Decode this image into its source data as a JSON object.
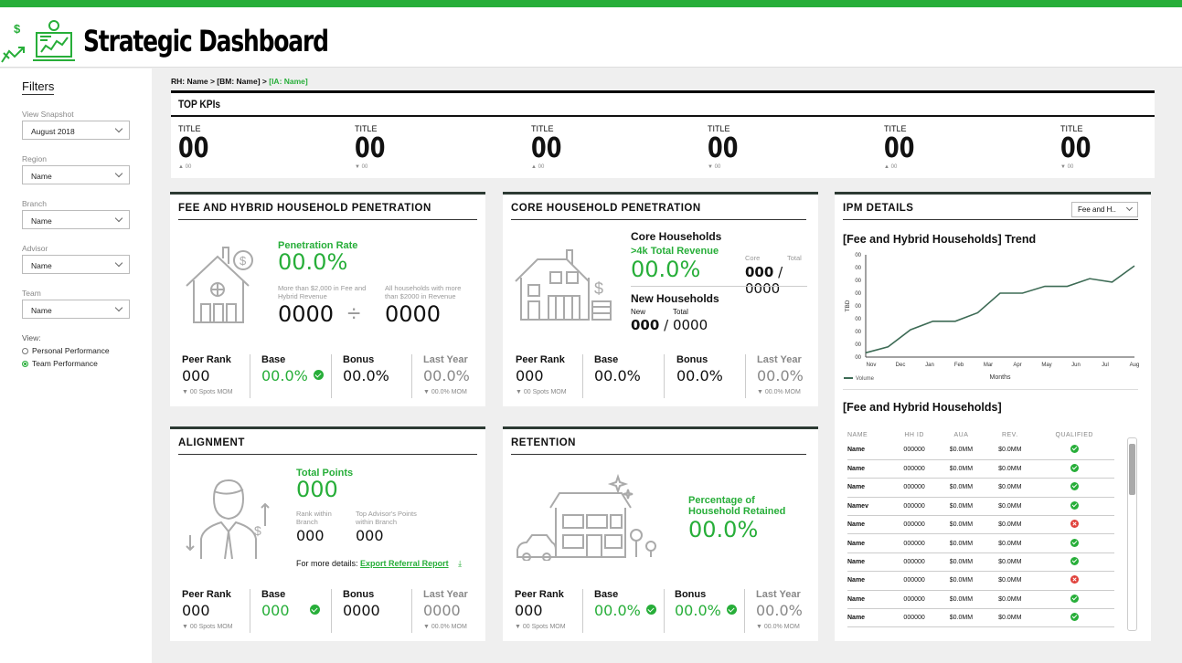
{
  "app": {
    "title": "Strategic Dashboard"
  },
  "sidebar": {
    "title": "Filters",
    "filters": [
      {
        "label": "View Snapshot",
        "value": "August 2018"
      },
      {
        "label": "Region",
        "value": "Name"
      },
      {
        "label": "Branch",
        "value": "Name"
      },
      {
        "label": "Advisor",
        "value": "Name"
      },
      {
        "label": "Team",
        "value": "Name"
      }
    ],
    "view_label": "View:",
    "view_options": [
      {
        "label": "Personal Performance",
        "selected": false
      },
      {
        "label": "Team Performance",
        "selected": true
      }
    ]
  },
  "breadcrumb": {
    "path": "RH: Name > [BM: Name]  >",
    "current": "[IA: Name]"
  },
  "kpis": {
    "title": "TOP KPIs",
    "items": [
      {
        "title": "TITLE",
        "value": "00",
        "change": "▲ 00",
        "trend": "up"
      },
      {
        "title": "TITLE",
        "value": "00",
        "change": "▼ 00",
        "trend": "down"
      },
      {
        "title": "TITLE",
        "value": "00",
        "change": "▲ 00",
        "trend": "up"
      },
      {
        "title": "TITLE",
        "value": "00",
        "change": "▼ 00",
        "trend": "down"
      },
      {
        "title": "TITLE",
        "value": "00",
        "change": "▲ 00",
        "trend": "up"
      },
      {
        "title": "TITLE",
        "value": "00",
        "change": "▼ 00",
        "trend": "down"
      }
    ]
  },
  "fee_card": {
    "title": "FEE AND HYBRID HOUSEHOLD PENETRATION",
    "rate_label": "Penetration Rate",
    "rate_value": "00.0%",
    "num_desc": "More than $2,000 in Fee and Hybrid Revenue",
    "den_desc": "All households with more than $2000 in Revenue",
    "num": "0000",
    "divide": "÷",
    "den": "0000",
    "peer_label": "Peer Rank",
    "peer_value": "000",
    "peer_sub": "▼ 00 Spots MOM",
    "base_label": "Base",
    "base_value": "00.0%",
    "bonus_label": "Bonus",
    "bonus_value": "00.0%",
    "ly_label": "Last Year",
    "ly_value": "00.0%",
    "ly_sub": "▼ 00.0% MOM"
  },
  "core_card": {
    "title": "CORE HOUSEHOLD PENETRATION",
    "core_title": "Core Households",
    "core_sub": ">4k Total Revenue",
    "core_value": "00.0%",
    "core_col": "Core",
    "total_col": "Total",
    "core_num": "000",
    "slash": "/",
    "core_total": "0000",
    "new_title": "New Households",
    "new_col": "New",
    "new_total_col": "Total",
    "new_num": "000",
    "new_total": "0000",
    "peer_label": "Peer Rank",
    "peer_value": "000",
    "peer_sub": "▼ 00 Spots MOM",
    "base_label": "Base",
    "base_value": "00.0%",
    "bonus_label": "Bonus",
    "bonus_value": "00.0%",
    "ly_label": "Last Year",
    "ly_value": "00.0%",
    "ly_sub": "▼ 00.0% MOM"
  },
  "align_card": {
    "title": "ALIGNMENT",
    "points_label": "Total Points",
    "points_value": "000",
    "rank_label": "Rank within Branch",
    "rank_value": "000",
    "top_label": "Top Advisor's Points within Branch",
    "top_value": "000",
    "details_text": "For more details:",
    "details_link": "Export Referral Report",
    "peer_label": "Peer Rank",
    "peer_value": "000",
    "peer_sub": "▼ 00 Spots MOM",
    "base_label": "Base",
    "base_value": "000",
    "bonus_label": "Bonus",
    "bonus_value": "0000",
    "ly_label": "Last Year",
    "ly_value": "0000",
    "ly_sub": "▼ 00.0% MOM"
  },
  "ret_card": {
    "title": "RETENTION",
    "pct_label": "Percentage of Household Retained",
    "pct_value": "00.0%",
    "peer_label": "Peer Rank",
    "peer_value": "000",
    "peer_sub": "▼ 00 Spots MOM",
    "base_label": "Base",
    "base_value": "00.0%",
    "bonus_label": "Bonus",
    "bonus_value": "00.0%",
    "ly_label": "Last Year",
    "ly_value": "00.0%",
    "ly_sub": "▼ 00.0% MOM"
  },
  "ipm": {
    "title": "IPM DETAILS",
    "dropdown": "Fee and H..",
    "trend_title": "[Fee and Hybrid Households] Trend",
    "table_title": "[Fee and Hybrid Households]",
    "columns": [
      "NAME",
      "HH ID",
      "AUA",
      "REV.",
      "QUALIFIED"
    ],
    "rows": [
      {
        "name": "Name",
        "id": "000000",
        "aua": "$0.0MM",
        "rev": "$0.0MM",
        "qualified": true
      },
      {
        "name": "Name",
        "id": "000000",
        "aua": "$0.0MM",
        "rev": "$0.0MM",
        "qualified": true
      },
      {
        "name": "Name",
        "id": "000000",
        "aua": "$0.0MM",
        "rev": "$0.0MM",
        "qualified": true
      },
      {
        "name": "Namev",
        "id": "000000",
        "aua": "$0.0MM",
        "rev": "$0.0MM",
        "qualified": true
      },
      {
        "name": "Name",
        "id": "000000",
        "aua": "$0.0MM",
        "rev": "$0.0MM",
        "qualified": false
      },
      {
        "name": "Name",
        "id": "000000",
        "aua": "$0.0MM",
        "rev": "$0.0MM",
        "qualified": true
      },
      {
        "name": "Name",
        "id": "000000",
        "aua": "$0.0MM",
        "rev": "$0.0MM",
        "qualified": true
      },
      {
        "name": "Name",
        "id": "000000",
        "aua": "$0.0MM",
        "rev": "$0.0MM",
        "qualified": false
      },
      {
        "name": "Name",
        "id": "000000",
        "aua": "$0.0MM",
        "rev": "$0.0MM",
        "qualified": true
      },
      {
        "name": "Name",
        "id": "000000",
        "aua": "$0.0MM",
        "rev": "$0.0MM",
        "qualified": true
      }
    ]
  },
  "chart_data": {
    "type": "line",
    "categories": [
      "Nov",
      "Dec",
      "Jan",
      "Feb",
      "Mar",
      "Apr",
      "May",
      "Jun",
      "Jul",
      "Aug"
    ],
    "series": [
      {
        "name": "Volume",
        "values": [
          0.5,
          1.2,
          3.2,
          4.2,
          4.2,
          5.2,
          7.5,
          7.5,
          8.3,
          8.3,
          9.2,
          8.8,
          10.7
        ]
      }
    ],
    "x_points": 13,
    "ytick_labels": [
      "00",
      "00",
      "00",
      "00",
      "00",
      "00",
      "00",
      "00",
      "00"
    ],
    "xlabel": "Months",
    "ylabel": "TBD",
    "ylim": [
      0,
      12
    ],
    "legend": "bottom-left"
  },
  "colors": {
    "brand": "#27ae39",
    "negative": "#e0403a",
    "line": "#3d6b55"
  }
}
